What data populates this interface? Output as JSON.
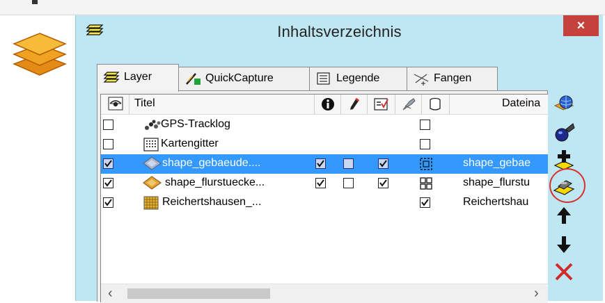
{
  "window": {
    "title": "Inhaltsverzeichnis",
    "close_label": "×"
  },
  "tabs": [
    {
      "label": "Layer",
      "icon": "layers-icon",
      "active": true
    },
    {
      "label": "QuickCapture",
      "icon": "pencil-capture-icon",
      "active": false
    },
    {
      "label": "Legende",
      "icon": "legend-icon",
      "active": false
    },
    {
      "label": "Fangen",
      "icon": "snap-icon",
      "active": false
    }
  ],
  "columns": {
    "visible_icon": "eye-icon",
    "title": "Titel",
    "info_icon": "info-icon",
    "edit_icon": "pencil-icon",
    "selectable_icon": "selection-icon",
    "snap_icon": "snap-icon",
    "file_icon": "cylinder-icon",
    "file": "Dateina"
  },
  "rows": [
    {
      "title": "GPS-Tracklog",
      "icon": "gps-track-icon",
      "visible": false,
      "selected": false,
      "file": ""
    },
    {
      "title": "Kartengitter",
      "icon": "grid-icon",
      "visible": false,
      "selected": false,
      "file": ""
    },
    {
      "title": "shape_gebaeude....",
      "icon": "polygon-layer-icon",
      "visible": true,
      "selected": true,
      "file": "shape_gebae"
    },
    {
      "title": "shape_flurstuecke...",
      "icon": "polygon-layer-icon",
      "visible": true,
      "selected": false,
      "file": "shape_flurstu"
    },
    {
      "title": "Reichertshausen_...",
      "icon": "raster-layer-icon",
      "visible": true,
      "selected": false,
      "file": "Reichertshau"
    }
  ],
  "toolbar": [
    "add-web-layer-icon",
    "add-gps-layer-icon",
    "add-layer-icon",
    "layer-properties-icon",
    "move-up-icon",
    "move-down-icon",
    "remove-layer-icon"
  ],
  "colors": {
    "window_bg": "#bfe6f3",
    "selection": "#3399ff",
    "close_button": "#c4413c",
    "highlight_circle": "#d9302c"
  }
}
